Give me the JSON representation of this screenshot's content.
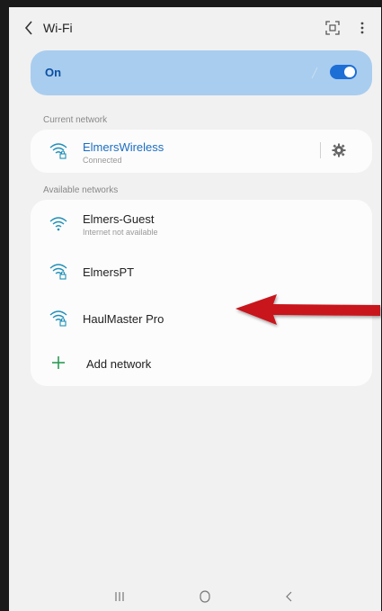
{
  "topbar": {
    "title": "Wi-Fi",
    "back_icon": "chevron-left-icon",
    "scan_icon": "qr-scan-icon",
    "more_icon": "more-vertical-icon"
  },
  "wifi_toggle": {
    "label": "On",
    "state": true,
    "accent": "#1d6fd6",
    "card_color": "#a9cdef"
  },
  "current_network": {
    "section_label": "Current network",
    "name": "ElmersWireless",
    "status": "Connected",
    "settings_icon": "gear-icon"
  },
  "available_networks": {
    "section_label": "Available networks",
    "items": [
      {
        "name": "Elmers-Guest",
        "status": "Internet not available",
        "secured": false
      },
      {
        "name": "ElmersPT",
        "status": "",
        "secured": true
      },
      {
        "name": "HaulMaster Pro",
        "status": "",
        "secured": true
      }
    ],
    "add_label": "Add network"
  },
  "annotation": {
    "arrow_color": "#c8141b"
  },
  "navbar": {
    "recent_icon": "recent-apps-icon",
    "home_icon": "home-icon",
    "back_icon": "back-icon"
  }
}
